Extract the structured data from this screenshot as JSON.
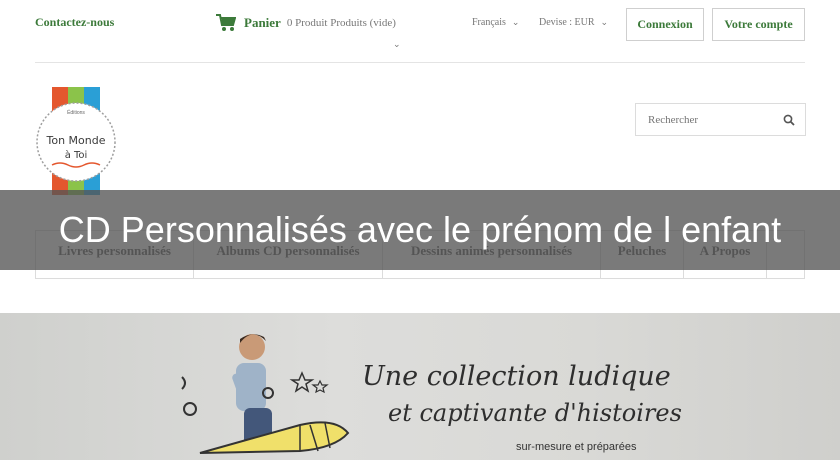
{
  "header": {
    "contact_label": "Contactez-nous",
    "cart_label": "Panier",
    "cart_status": "0 Produit Produits (vide)",
    "language": "Français",
    "currency": "Devise : EUR",
    "login_label": "Connexion",
    "account_label": "Votre compte"
  },
  "logo": {
    "top_text": "Éditions",
    "line1": "Ton Monde",
    "line2": "à Toi"
  },
  "search": {
    "placeholder": "Rechercher"
  },
  "nav": {
    "items": [
      {
        "label": "Livres personnalisés"
      },
      {
        "label": "Albums CD personnalisés"
      },
      {
        "label": "Dessins animés personnalisés"
      },
      {
        "label": "Peluches"
      },
      {
        "label": "A Propos"
      },
      {
        "label": ""
      }
    ]
  },
  "overlay": {
    "title": "CD Personnalisés avec le prénom de l enfant"
  },
  "banner": {
    "title": "Une collection ludique",
    "subtitle": "et captivante d'histoires",
    "small_text": "sur-mesure et préparées"
  },
  "colors": {
    "accent": "#3c7a3a",
    "overlay": "#555555"
  }
}
